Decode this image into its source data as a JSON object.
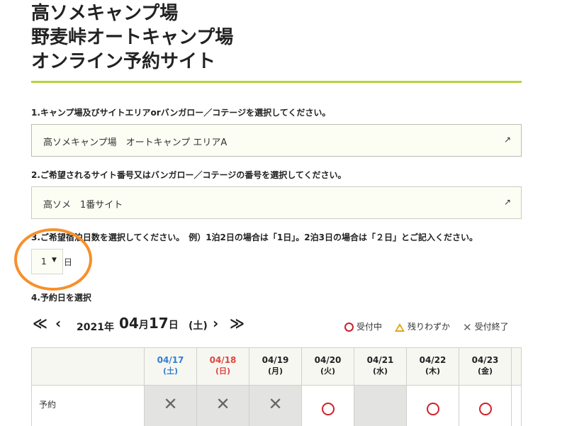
{
  "title": {
    "line1": "高ソメキャンプ場",
    "line2": "野麦峠オートキャンプ場",
    "line3": "オンライン予約サイト"
  },
  "step1": {
    "label": "1.キャンプ場及びサイトエリアorバンガロー／コテージを選択してください。",
    "value": "高ソメキャンプ場　オートキャンプ エリアA",
    "arrow": "↗"
  },
  "step2": {
    "label": "2.ご希望されるサイト番号又はバンガロー／コテージの番号を選択してください。",
    "value": "高ソメ　1番サイト",
    "arrow": "↗"
  },
  "step3": {
    "label": "3.ご希望宿泊日数を選択してください。　例）1泊2日の場合は「1日」。2泊3日の場合は「２日」とご記入ください。",
    "nights_value": "1",
    "caret": "▼",
    "unit": "日"
  },
  "step4": {
    "label": "4.予約日を選択"
  },
  "date_nav": {
    "first": "≪",
    "prev": "‹",
    "year": "2021年",
    "month": "04",
    "month_suffix": "月",
    "day": "17",
    "day_suffix": "日",
    "dow": "(土)",
    "next": "›",
    "last": "≫"
  },
  "legend": {
    "open": "受付中",
    "few": "残りわずか",
    "closed": "受付終了"
  },
  "calendar": {
    "row_label": "予約",
    "days": [
      {
        "date": "04/17",
        "dow": "(土)",
        "color": "#2f7fd4",
        "status": "closed"
      },
      {
        "date": "04/18",
        "dow": "(日)",
        "color": "#e0443e",
        "status": "closed"
      },
      {
        "date": "04/19",
        "dow": "(月)",
        "color": "#222222",
        "status": "closed"
      },
      {
        "date": "04/20",
        "dow": "(火)",
        "color": "#222222",
        "status": "open"
      },
      {
        "date": "04/21",
        "dow": "(水)",
        "color": "#222222",
        "status": "blank"
      },
      {
        "date": "04/22",
        "dow": "(木)",
        "color": "#222222",
        "status": "open"
      },
      {
        "date": "04/23",
        "dow": "(金)",
        "color": "#222222",
        "status": "open"
      }
    ]
  },
  "colors": {
    "accent_rule": "#b5d43a",
    "annotation": "#f7902b",
    "open_mark": "#d0202a",
    "few_mark": "#e2a416"
  }
}
